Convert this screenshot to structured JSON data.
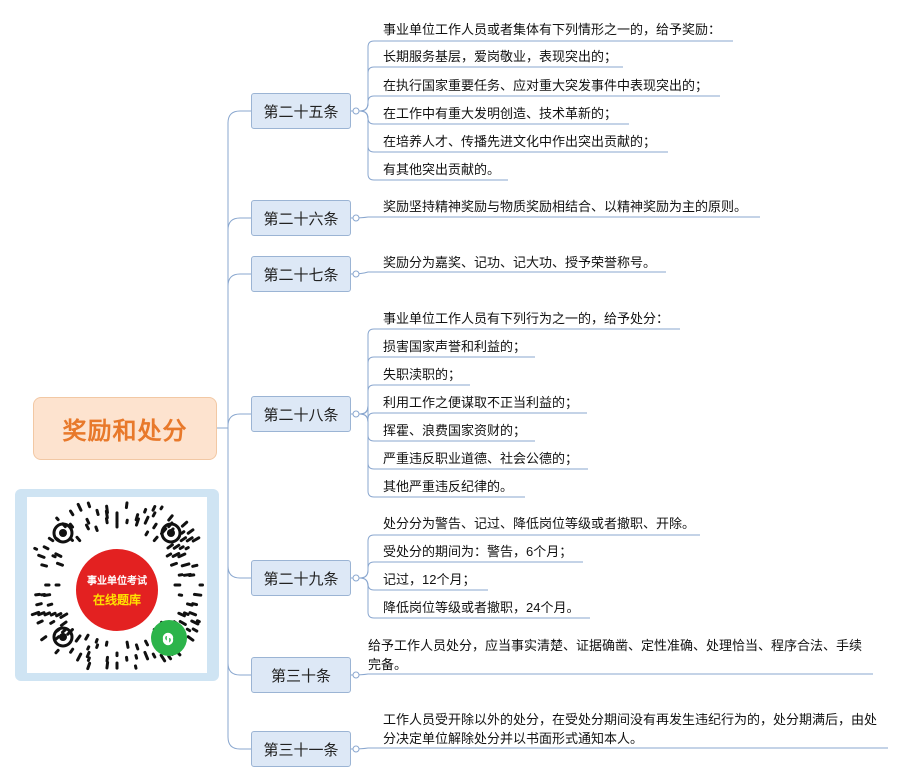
{
  "root": "奖励和处分",
  "badge": {
    "line1": "事业单位考试",
    "line2": "在线题库"
  },
  "branches": [
    {
      "label": "第二十五条",
      "items": [
        "事业单位工作人员或者集体有下列情形之一的，给予奖励：",
        "长期服务基层，爱岗敬业，表现突出的；",
        "在执行国家重要任务、应对重大突发事件中表现突出的；",
        "在工作中有重大发明创造、技术革新的；",
        "在培养人才、传播先进文化中作出突出贡献的；",
        "有其他突出贡献的。"
      ]
    },
    {
      "label": "第二十六条",
      "items": [
        "奖励坚持精神奖励与物质奖励相结合、以精神奖励为主的原则。"
      ]
    },
    {
      "label": "第二十七条",
      "items": [
        "奖励分为嘉奖、记功、记大功、授予荣誉称号。"
      ]
    },
    {
      "label": "第二十八条",
      "items": [
        "事业单位工作人员有下列行为之一的，给予处分：",
        "损害国家声誉和利益的；",
        "失职渎职的；",
        "利用工作之便谋取不正当利益的；",
        "挥霍、浪费国家资财的；",
        "严重违反职业道德、社会公德的；",
        "其他严重违反纪律的。"
      ]
    },
    {
      "label": "第二十九条",
      "items": [
        "处分分为警告、记过、降低岗位等级或者撤职、开除。",
        "受处分的期间为：警告，6个月；",
        "记过，12个月；",
        "降低岗位等级或者撤职，24个月。"
      ]
    },
    {
      "label": "第三十条",
      "items": [
        "给予工作人员处分，应当事实清楚、证据确凿、定性准确、处理恰当、程序合法、手续完备。"
      ]
    },
    {
      "label": "第三十一条",
      "items": [
        "工作人员受开除以外的处分，在受处分期间没有再发生违纪行为的，处分期满后，由处分决定单位解除处分并以书面形式通知本人。"
      ]
    }
  ]
}
